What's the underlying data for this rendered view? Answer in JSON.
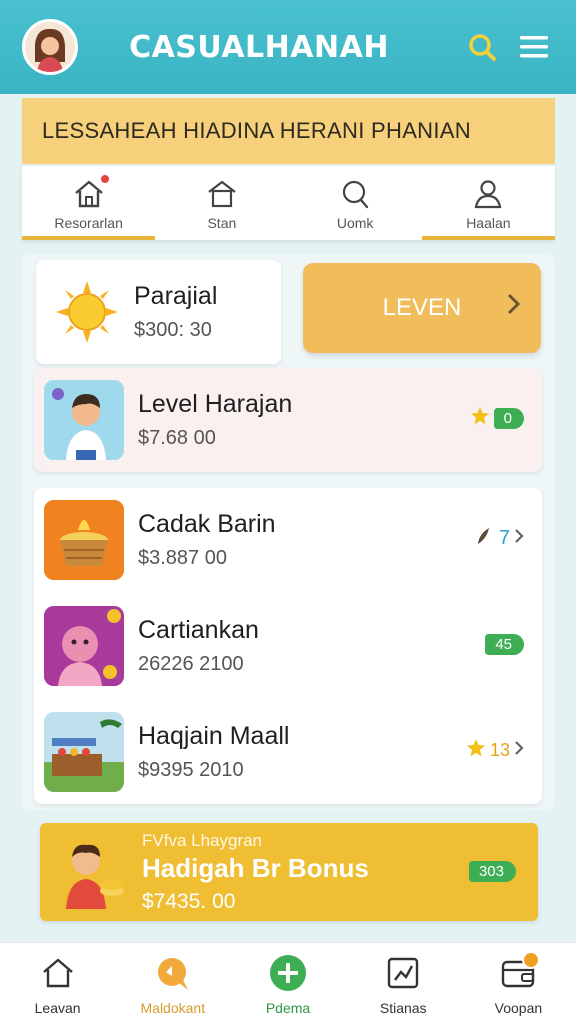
{
  "header": {
    "title": "CASUALHANAH",
    "avatar": "avatar",
    "search_icon": "search-icon",
    "menu_icon": "hamburger-menu-icon"
  },
  "banner": {
    "text": "LESSAHEAH HIADINA HERANI PHANIAN"
  },
  "tabs": [
    {
      "label": "Resorarlan",
      "icon": "house-icon",
      "active": true,
      "notification": true
    },
    {
      "label": "Stan",
      "icon": "house-outline-icon",
      "active": false
    },
    {
      "label": "Uomk",
      "icon": "search-icon",
      "active": false
    },
    {
      "label": "Haalan",
      "icon": "person-icon",
      "active": true
    }
  ],
  "featured": {
    "title": "Parajial",
    "price": "$300: 30",
    "icon": "sun-icon"
  },
  "leven_button": {
    "label": "LEVEN"
  },
  "items": [
    {
      "title": "Level Harajan",
      "price": "$7.68 00",
      "badge_value": "0",
      "badge_icon": "star-icon",
      "highlight": true
    },
    {
      "title": "Cadak Barin",
      "price": "$3.887 00",
      "badge_value": "7",
      "badge_icon": "feather-icon"
    },
    {
      "title": "Cartiankan",
      "price": "26226 2100",
      "badge_value": "45",
      "badge_icon": "tag-icon"
    },
    {
      "title": "Haqjain Maall",
      "price": "$9395 2010",
      "badge_value": "13",
      "badge_icon": "star-icon"
    }
  ],
  "bonus": {
    "subtitle": "FVfva Lhaygran",
    "title": "Hadigah Br Bonus",
    "price": "$7435. 00",
    "badge_value": "303"
  },
  "bottom_nav": [
    {
      "label": "Leavan",
      "icon": "house-icon"
    },
    {
      "label": "Maldokant",
      "icon": "chat-icon"
    },
    {
      "label": "Pdema",
      "icon": "plus-circle-icon"
    },
    {
      "label": "Stianas",
      "icon": "stats-icon"
    },
    {
      "label": "Voopan",
      "icon": "wallet-icon"
    }
  ],
  "colors": {
    "header": "#3ab3c3",
    "banner": "#f6d07a",
    "accent": "#e9b43a",
    "button": "#f1bd5a",
    "bonus": "#efbe33",
    "green": "#3eae55"
  }
}
